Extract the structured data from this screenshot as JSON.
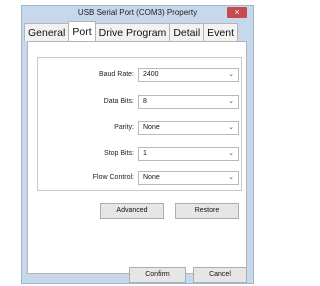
{
  "window": {
    "title": "USB Serial Port (COM3) Property",
    "close": "×"
  },
  "tabs": [
    {
      "label": "General"
    },
    {
      "label": "Port"
    },
    {
      "label": "Drive Program"
    },
    {
      "label": "Detail"
    },
    {
      "label": "Event"
    }
  ],
  "fields": {
    "baud_rate": {
      "label": "Baud Rate:",
      "value": "2400"
    },
    "data_bits": {
      "label": "Data Bits:",
      "value": "8"
    },
    "parity": {
      "label": "Parity:",
      "value": "None"
    },
    "stop_bits": {
      "label": "Stop Bits:",
      "value": "1"
    },
    "flow_control": {
      "label": "Flow Control:",
      "value": "None"
    }
  },
  "chevron": "⌄",
  "buttons": {
    "advanced": "Advanced",
    "restore": "Restore",
    "confirm": "Confirm",
    "cancel": "Cancel"
  }
}
